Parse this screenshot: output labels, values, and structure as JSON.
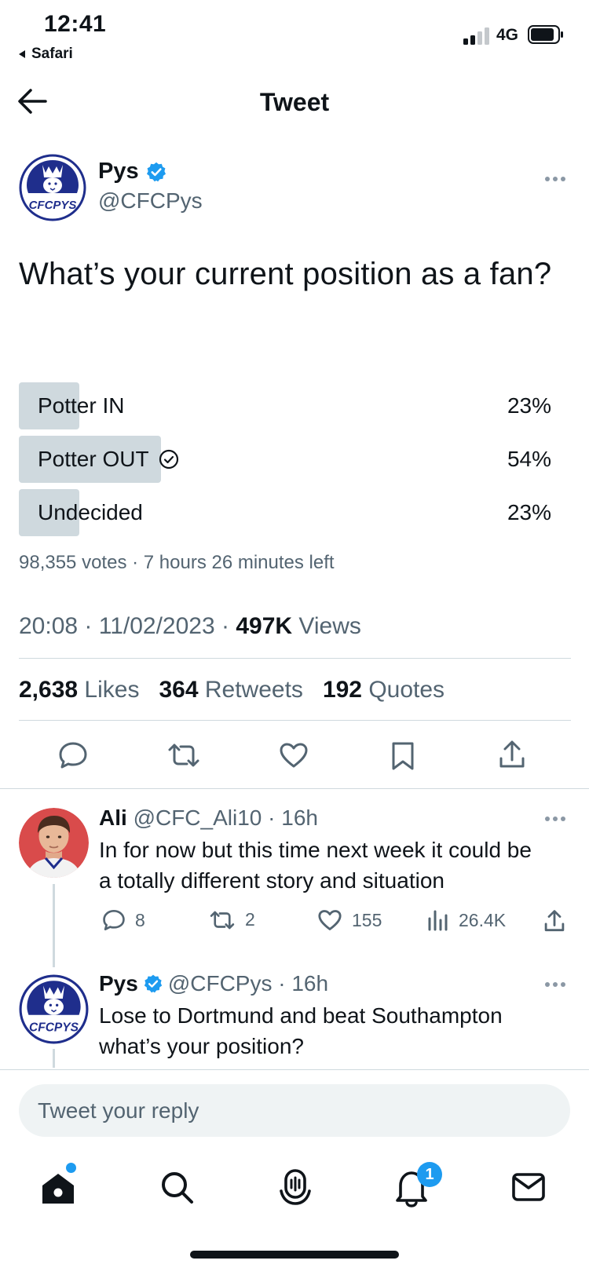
{
  "status_bar": {
    "time": "12:41",
    "back_app": "Safari",
    "network": "4G"
  },
  "header": {
    "title": "Tweet",
    "back_icon": "arrow-left-icon"
  },
  "tweet": {
    "author": {
      "name": "Pys",
      "handle": "@CFCPys",
      "avatar_text": "CFCPYS",
      "verified": true
    },
    "text": "What’s your current position as a fan?",
    "poll": {
      "options": [
        {
          "label": "Potter IN",
          "percent": "23%",
          "value": 23,
          "winner": false
        },
        {
          "label": "Potter OUT",
          "percent": "54%",
          "value": 54,
          "winner": true
        },
        {
          "label": "Undecided",
          "percent": "23%",
          "value": 23,
          "winner": false
        }
      ],
      "summary": "98,355 votes · 7 hours 26 minutes left"
    },
    "timestamp": "20:08 · 11/02/2023 · ",
    "views_count": "497K",
    "views_label": " Views",
    "stats": {
      "likes_count": "2,638",
      "likes_label": " Likes",
      "retweets_count": "364",
      "retweets_label": " Retweets",
      "quotes_count": "192",
      "quotes_label": " Quotes"
    }
  },
  "replies": [
    {
      "name": "Ali",
      "handle": "@CFC_Ali10 · 16h",
      "text": "In for now but this time next week it could be a totally different story and situation",
      "replies": "8",
      "retweets": "2",
      "likes": "155",
      "views": "26.4K"
    },
    {
      "name": "Pys",
      "handle": "@CFCPys · 16h",
      "avatar_text": "CFCPYS",
      "text": "Lose to Dortmund and beat Southampton what’s your position?"
    }
  ],
  "compose": {
    "placeholder": "Tweet your reply"
  },
  "tab_bar": {
    "notifications_badge": "1"
  },
  "colors": {
    "accent": "#1d9bf0",
    "poll_bar": "#cfd9de",
    "muted_text": "#536471",
    "brand_blue": "#1f2e8c"
  }
}
